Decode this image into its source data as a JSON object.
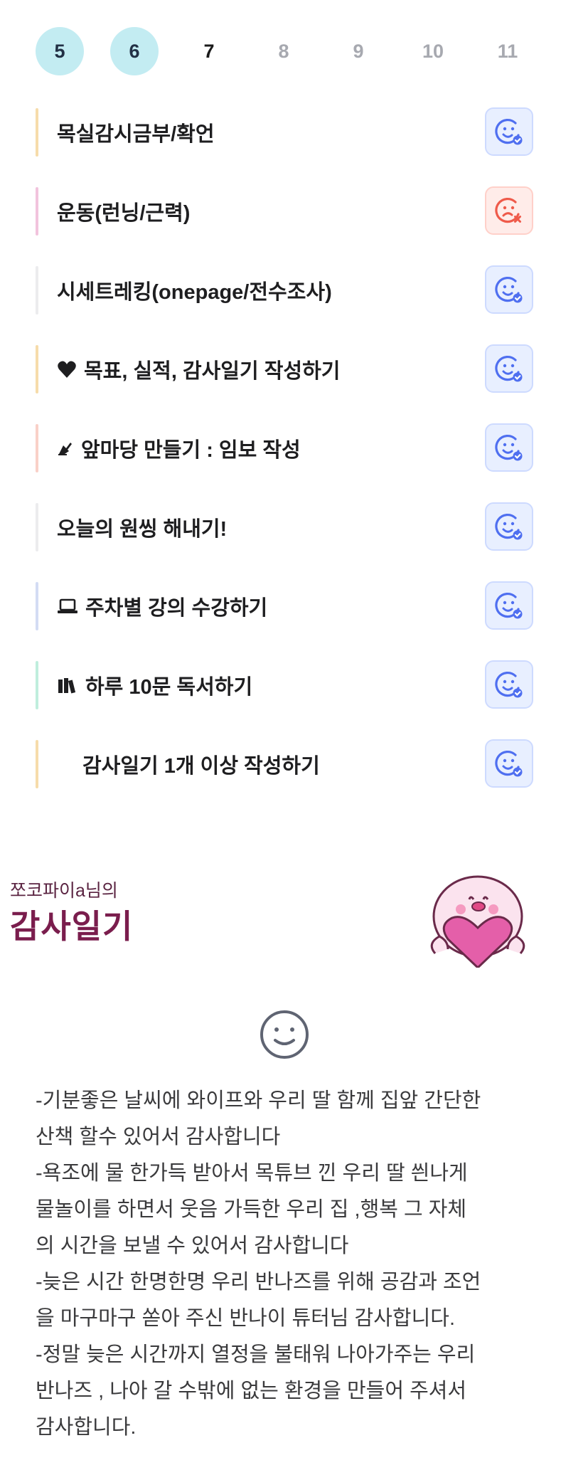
{
  "days": [
    {
      "label": "5",
      "state": "selected"
    },
    {
      "label": "6",
      "state": "selected"
    },
    {
      "label": "7",
      "state": "today"
    },
    {
      "label": "8",
      "state": "future"
    },
    {
      "label": "9",
      "state": "future"
    },
    {
      "label": "10",
      "state": "future"
    },
    {
      "label": "11",
      "state": "future"
    }
  ],
  "habits": [
    {
      "label": "목실감시금부/확언",
      "icon": "",
      "status": "done",
      "bar_color": "#f6dcaa"
    },
    {
      "label": "운동(런닝/근력)",
      "icon": "",
      "status": "fail",
      "bar_color": "#f2c3dd"
    },
    {
      "label": "시세트레킹(onepage/전수조사)",
      "icon": "",
      "status": "done",
      "bar_color": "#ececee"
    },
    {
      "label": "목표, 실적, 감사일기 작성하기",
      "icon": "heart-icon",
      "status": "done",
      "bar_color": "#f6dcaa"
    },
    {
      "label": "앞마당 만들기 : 임보 작성",
      "icon": "writing-hand-icon",
      "status": "done",
      "bar_color": "#f9d0c8"
    },
    {
      "label": "오늘의 원씽 해내기!",
      "icon": "",
      "status": "done",
      "bar_color": "#ececee"
    },
    {
      "label": "주차별 강의 수강하기",
      "icon": "laptop-icon",
      "status": "done",
      "bar_color": "#d3dcf4"
    },
    {
      "label": "하루 10문 독서하기",
      "icon": "books-icon",
      "status": "done",
      "bar_color": "#bfeedd"
    },
    {
      "label": "감사일기 1개 이상 작성하기",
      "icon": "blank-icon",
      "status": "done",
      "bar_color": "#f6dcaa"
    }
  ],
  "status_icons": {
    "done": "smiley-check-icon",
    "fail": "sad-x-icon"
  },
  "diary": {
    "owner": "쪼코파이a님의",
    "title": "감사일기",
    "mascot_icon": "pink-mascot-holding-heart",
    "mood_icon": "smiley-face-icon",
    "text": "-기분좋은 날씨에 와이프와 우리 딸 함께 집앞 간단한 산책 할수 있어서 감사합니다\n-욕조에 물 한가득 받아서 목튜브 낀 우리 딸 씐나게 물놀이를 하면서 웃음 가득한 우리 집 ,행복 그 자체의 시간을 보낼 수 있어서 감사합니다\n-늦은 시간 한명한명 우리 반나즈를 위해 공감과 조언을 마구마구 쏟아 주신 반나이 튜터님 감사합니다.\n-정말 늦은 시간까지 열정을 불태워 나아가주는 우리 반나즈 , 나아 갈 수밖에 없는 환경을 만들어 주셔서 감사합니다.",
    "text_lines": [
      "-기분좋은 날씨에 와이프와 우리 딸 함께 집앞 간단한",
      "산책 할수 있어서 감사합니다",
      "-욕조에 물 한가득 받아서 목튜브 낀 우리 딸 씐나게",
      "물놀이를 하면서 웃음 가득한 우리 집 ,행복 그 자체",
      "의 시간을 보낼 수 있어서 감사합니다",
      "-늦은 시간 한명한명 우리 반나즈를 위해 공감과 조언",
      "을 마구마구 쏟아 주신 반나이 튜터님 감사합니다.",
      "-정말 늦은 시간까지 열정을 불태워 나아가주는 우리",
      "반나즈 , 나아 갈 수밖에 없는 환경을 만들어 주셔서",
      "감사합니다."
    ]
  },
  "colors": {
    "selected_day_bg": "#c3ecf2",
    "done_bg": "#e8efff",
    "done_icon": "#4f6ff0",
    "fail_bg": "#ffece9",
    "fail_icon": "#ef5a4a",
    "diary_title": "#7a1d4d"
  }
}
